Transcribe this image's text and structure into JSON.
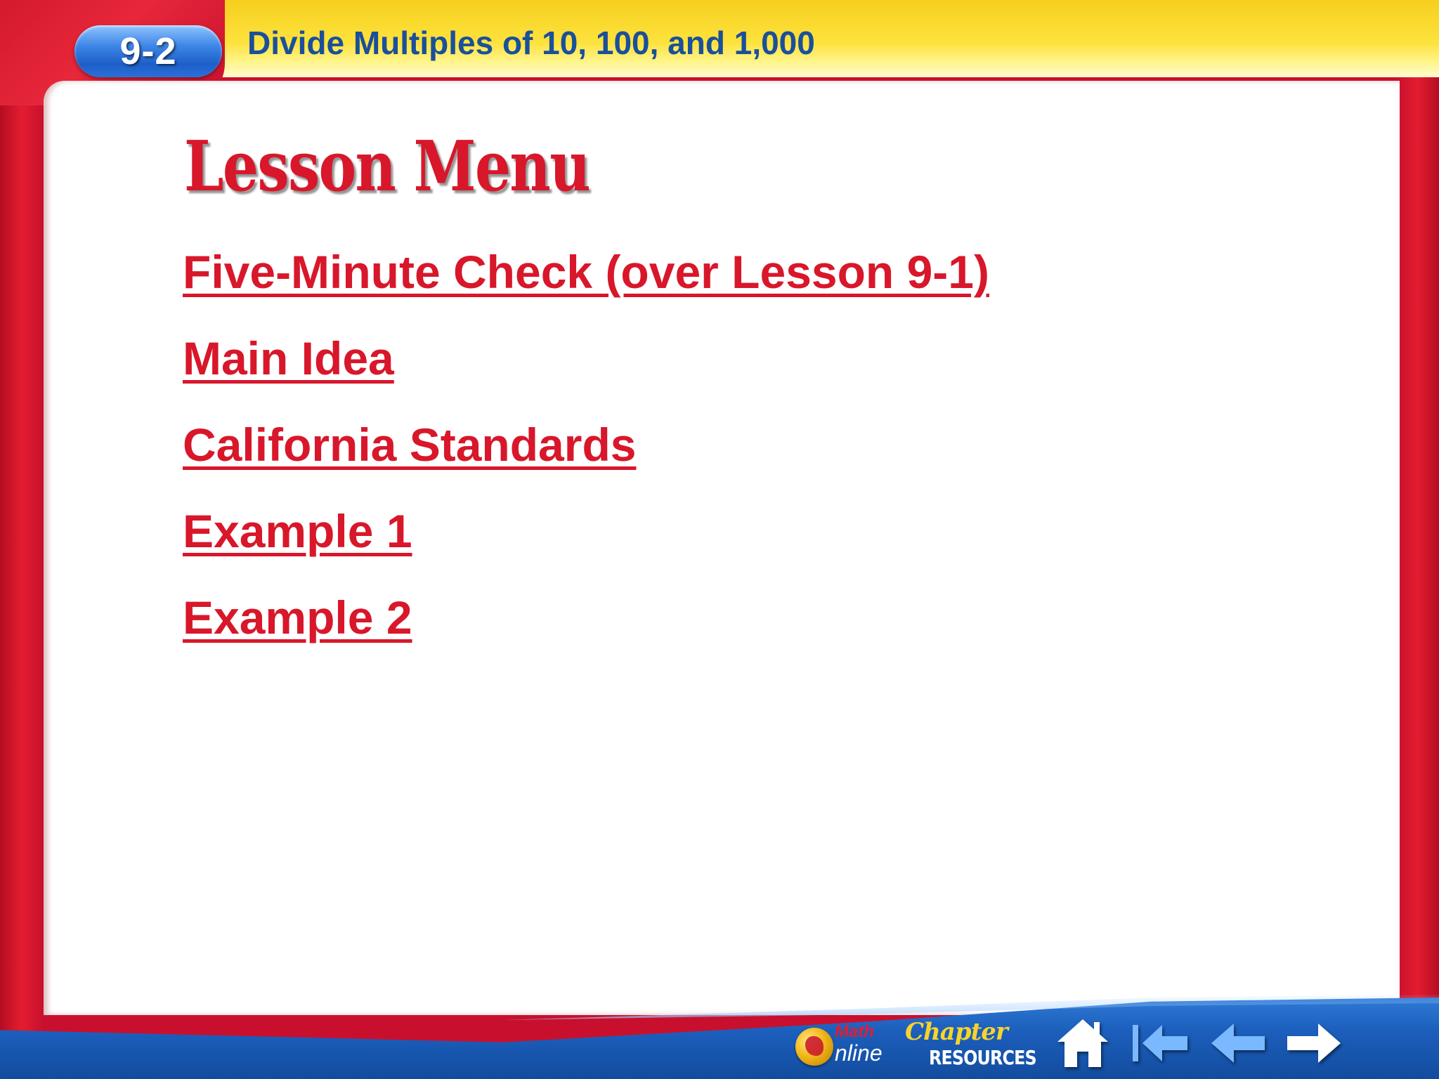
{
  "header": {
    "lesson_number": "9-2",
    "lesson_title": "Divide Multiples of 10, 100, and 1,000"
  },
  "main": {
    "heading": "Lesson Menu",
    "menu_items": [
      {
        "label": "Five-Minute Check (over Lesson 9-1)"
      },
      {
        "label": "Main Idea"
      },
      {
        "label": "California Standards"
      },
      {
        "label": "Example 1"
      },
      {
        "label": "Example 2"
      }
    ]
  },
  "footer": {
    "math_online_top": "Math",
    "math_online_bottom": "nline",
    "chapter_resources_top": "Chapter",
    "chapter_resources_bottom": "RESOURCES",
    "icons": [
      "home-icon",
      "first-slide-icon",
      "previous-arrow-icon",
      "next-arrow-icon"
    ]
  },
  "colors": {
    "frame_red": "#c8102e",
    "header_yellow": "#fde23d",
    "title_blue": "#1a4f9a",
    "link_red": "#d8172b",
    "footer_blue": "#1c5fbd"
  }
}
